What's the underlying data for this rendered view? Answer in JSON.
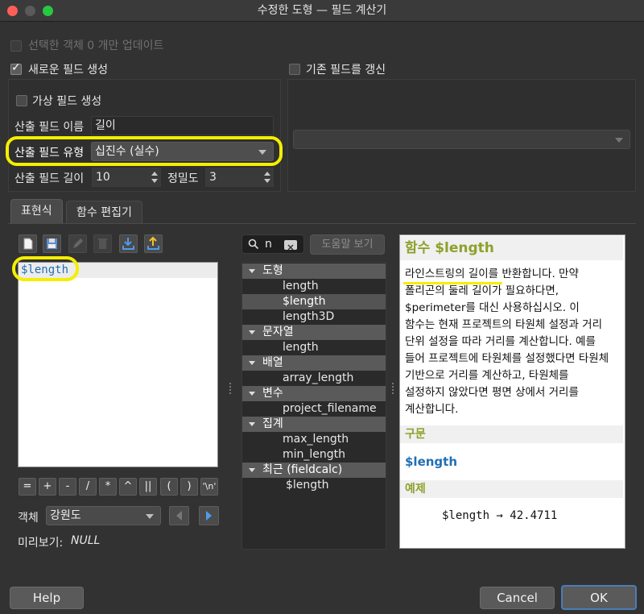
{
  "window": {
    "title": "수정한 도형 — 필드 계산기",
    "traffic_colors": [
      "#fe5f57",
      "#5a5a5a",
      "#28c840"
    ]
  },
  "top": {
    "update_selected": "선택한 객체 0 개만 업데이트",
    "create_new_field": "새로운 필드 생성",
    "create_new_field_checked": true,
    "update_existing": "기존 필드를 갱신",
    "virtual_field": "가상 필드 생성",
    "output_field_name_label": "산출 필드 이름",
    "output_field_name_value": "길이",
    "output_field_type_label": "산출 필드 유형",
    "output_field_type_value": "십진수 (실수)",
    "output_field_length_label": "산출 필드 길이",
    "output_field_length_value": "10",
    "precision_label": "정밀도",
    "precision_value": "3"
  },
  "tabs": [
    "표현식",
    "함수 편집기"
  ],
  "expression": {
    "text": "$length"
  },
  "operators": [
    "=",
    "+",
    "-",
    "/",
    "*",
    "^",
    "||",
    "(",
    ")",
    "'\\n'"
  ],
  "feature": {
    "label": "객체",
    "value": "강원도"
  },
  "preview": {
    "label": "미리보기:",
    "value": "NULL"
  },
  "search": {
    "value": "n",
    "help_button": "도움말 보기"
  },
  "tree": [
    {
      "group": "도형",
      "items": [
        "length",
        "$length",
        "length3D"
      ]
    },
    {
      "group": "문자열",
      "items": [
        "length"
      ]
    },
    {
      "group": "배열",
      "items": [
        "array_length"
      ]
    },
    {
      "group": "변수",
      "items": [
        "project_filename"
      ]
    },
    {
      "group": "집계",
      "items": [
        "max_length",
        "min_length"
      ]
    },
    {
      "group": "최근 (fieldcalc)",
      "items": [
        "$length"
      ]
    }
  ],
  "help": {
    "title": "함수 $length",
    "description": [
      "라인스트링의 길이를 반환합니다. 만약",
      "폴리곤의 둘레 길이가 필요하다면,",
      "$perimeter를 대신 사용하십시오. 이",
      "함수는 현재 프로젝트의 타원체 설정과 거리",
      "단위 설정을 따라 거리를 계산합니다. 예를",
      "들어 프로젝트에 타원체를 설정했다면 타원체",
      "기반으로 거리를 계산하고, 타원체를",
      "설정하지 않았다면 평면 상에서 거리를",
      "계산합니다."
    ],
    "syntax_header": "구문",
    "syntax": "$length",
    "example_header": "예제",
    "example": "$length → 42.4711"
  },
  "buttons": {
    "help": "Help",
    "cancel": "Cancel",
    "ok": "OK"
  },
  "colors": {
    "highlight": "#f5ee00",
    "accent_blue": "#1f6fb4",
    "help_green": "#8ea12b"
  }
}
